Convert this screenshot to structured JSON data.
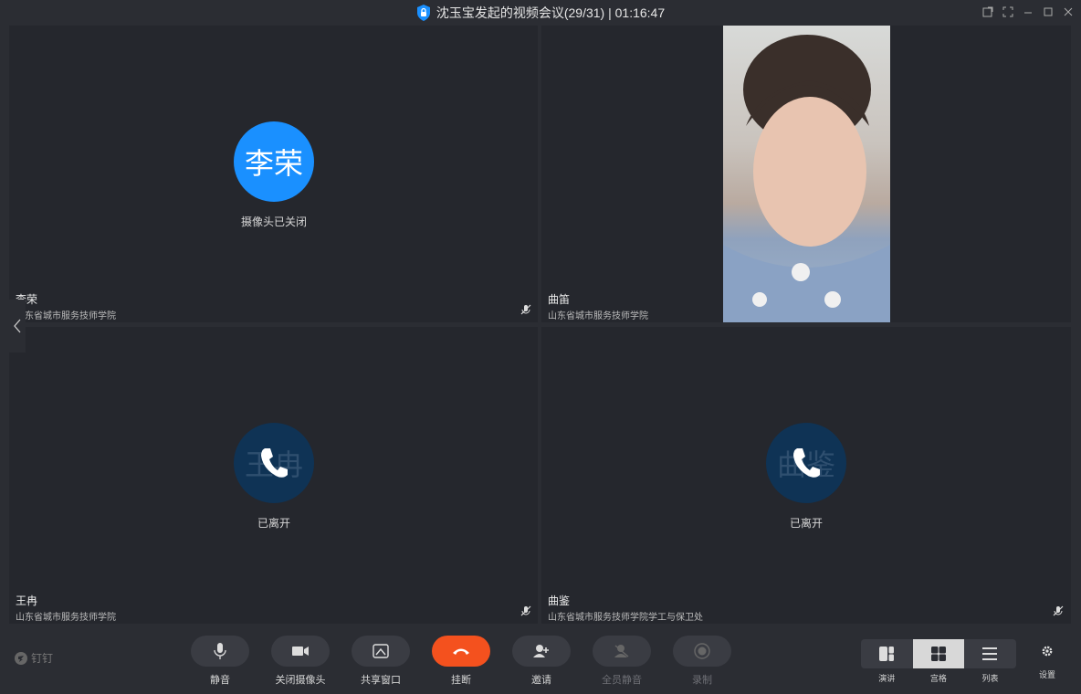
{
  "window": {
    "title": "沈玉宝发起的视频会议(29/31) | 01:16:47"
  },
  "tiles": [
    {
      "name": "李荣",
      "org": "山东省城市服务技师学院",
      "avatar_text": "李荣",
      "status": "摄像头已关闭"
    },
    {
      "name": "曲笛",
      "org": "山东省城市服务技师学院"
    },
    {
      "name": "王冉",
      "org": "山东省城市服务技师学院",
      "avatar_text": "王冉",
      "status": "已离开"
    },
    {
      "name": "曲鉴",
      "org": "山东省城市服务技师学院学工与保卫处",
      "avatar_text": "曲鉴",
      "status": "已离开"
    }
  ],
  "toolbar": {
    "brand": "钉钉",
    "mute": "静音",
    "camera_off": "关闭摄像头",
    "share": "共享窗口",
    "hangup": "挂断",
    "invite": "邀请",
    "mute_all": "全员静音",
    "record": "录制",
    "layouts": [
      "演讲",
      "宫格",
      "列表"
    ],
    "settings": "设置"
  },
  "colors": {
    "accent_blue": "#1a90ff",
    "hangup_red": "#f4511e",
    "background": "#2b2d33"
  }
}
